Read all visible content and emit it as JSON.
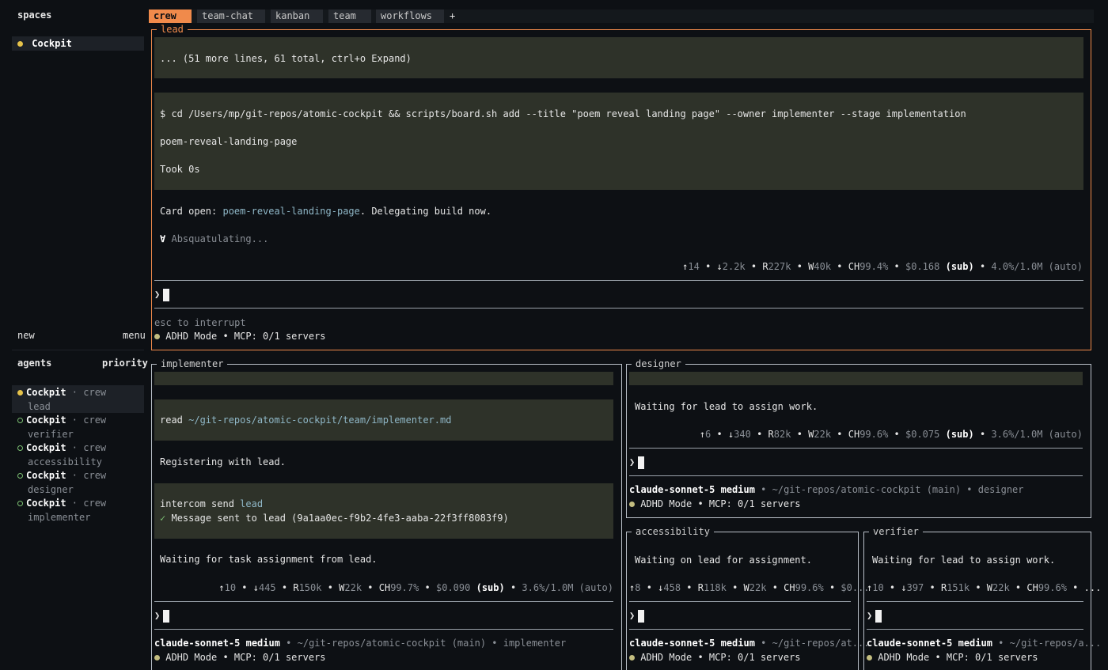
{
  "sidebar": {
    "spaces_heading": "spaces",
    "space": {
      "name": "Cockpit"
    },
    "new_label": "new",
    "menu_label": "menu",
    "agents_heading": "agents",
    "priority_label": "priority",
    "agents": [
      {
        "name": "Cockpit",
        "sep": " · crew",
        "role": "lead"
      },
      {
        "name": "Cockpit",
        "sep": " · crew",
        "role": "verifier"
      },
      {
        "name": "Cockpit",
        "sep": " · crew",
        "role": "accessibility"
      },
      {
        "name": "Cockpit",
        "sep": " · crew",
        "role": "designer"
      },
      {
        "name": "Cockpit",
        "sep": " · crew",
        "role": "implementer"
      }
    ]
  },
  "tabs": [
    "crew",
    "team-chat",
    "kanban",
    "team",
    "workflows"
  ],
  "tab_add": "+",
  "lead": {
    "title": "lead",
    "collapsed": "... (51 more lines, 61 total, ctrl+o Expand)",
    "command": "$ cd /Users/mp/git-repos/atomic-cockpit && scripts/board.sh add --title \"poem reveal landing page\" --owner implementer --stage implementation",
    "output": "poem-reveal-landing-page",
    "took": "Took 0s",
    "card_prefix": "Card open: ",
    "card_link": "poem-reveal-landing-page",
    "card_suffix": ". Delegating build now.",
    "spinner_glyph": "∀",
    "spinner_text": "Absquatulating...",
    "stats": {
      "up": "14",
      "down": "2.2k",
      "r": "227k",
      "w": "40k",
      "ch": "99.4%",
      "cost": "$0.168",
      "sub": "(sub)",
      "ctx": "4.0%/1.0M (auto)"
    },
    "prompt": "❯",
    "hint": "esc to interrupt",
    "mode": "ADHD Mode • MCP: 0/1 servers"
  },
  "implementer": {
    "title": "implementer",
    "read_prefix": "read ",
    "read_path": "~/git-repos/atomic-cockpit/team/implementer.md",
    "msg1": "Registering with lead.",
    "intercom_prefix": "intercom send ",
    "intercom_target": "lead",
    "check": "✓",
    "sent": "Message sent to lead (9a1aa0ec-f9b2-4fe3-aaba-22f3ff8083f9)",
    "msg2": "Waiting for task assignment from lead.",
    "stats": {
      "up": "10",
      "down": "445",
      "r": "150k",
      "w": "22k",
      "ch": "99.7%",
      "cost": "$0.090",
      "sub": "(sub)",
      "ctx": "3.6%/1.0M (auto)"
    },
    "prompt": "❯",
    "model": "claude-sonnet-5 medium",
    "info": " • ~/git-repos/atomic-cockpit (main) • implementer",
    "mode": "ADHD Mode • MCP: 0/1 servers"
  },
  "designer": {
    "title": "designer",
    "msg": "Waiting for lead to assign work.",
    "stats": {
      "up": "6",
      "down": "340",
      "r": "82k",
      "w": "22k",
      "ch": "99.6%",
      "cost": "$0.075",
      "sub": "(sub)",
      "ctx": "3.6%/1.0M (auto)"
    },
    "prompt": "❯",
    "model": "claude-sonnet-5 medium",
    "info": " • ~/git-repos/atomic-cockpit (main) • designer",
    "mode": "ADHD Mode • MCP: 0/1 servers"
  },
  "accessibility": {
    "title": "accessibility",
    "msg": "Waiting on lead for assignment.",
    "stats": {
      "up": "8",
      "down": "458",
      "r": "118k",
      "w": "22k",
      "ch": "99.6%",
      "cost": "$0..."
    },
    "prompt": "❯",
    "model": "claude-sonnet-5 medium",
    "info": " • ~/git-repos/at...",
    "mode": "ADHD Mode • MCP: 0/1 servers"
  },
  "verifier": {
    "title": "verifier",
    "msg": "Waiting for lead to assign work.",
    "stats": {
      "up": "10",
      "down": "397",
      "r": "151k",
      "w": "22k",
      "ch": "99.6%",
      "more": "..."
    },
    "prompt": "❯",
    "model": "claude-sonnet-5 medium",
    "info": " • ~/git-repos/a...",
    "mode": "ADHD Mode • MCP: 0/1 servers"
  },
  "colors": {
    "accent": "#f08a4b",
    "status": "#e6c34a",
    "idle": "#7cbf73",
    "link": "#8fb7c7"
  }
}
